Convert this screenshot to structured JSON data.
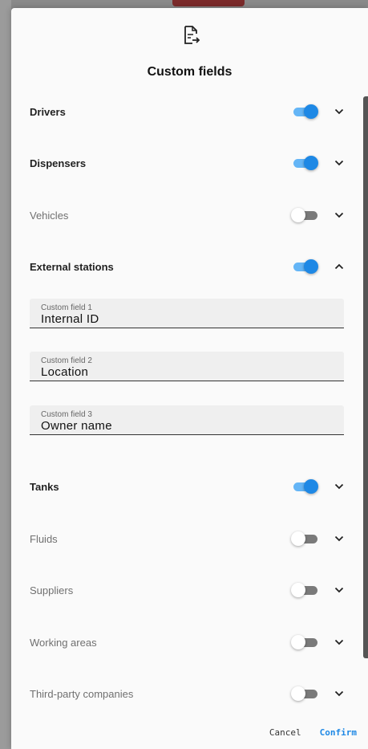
{
  "dialog": {
    "icon": "document-export-icon",
    "title": "Custom fields"
  },
  "sections": [
    {
      "id": "drivers",
      "label": "Drivers",
      "enabled": true,
      "expanded": false
    },
    {
      "id": "dispensers",
      "label": "Dispensers",
      "enabled": true,
      "expanded": false
    },
    {
      "id": "vehicles",
      "label": "Vehicles",
      "enabled": false,
      "expanded": false
    },
    {
      "id": "external-stations",
      "label": "External stations",
      "enabled": true,
      "expanded": true,
      "fields": [
        {
          "label": "Custom field 1",
          "value": "Internal ID"
        },
        {
          "label": "Custom field 2",
          "value": "Location"
        },
        {
          "label": "Custom field 3",
          "value": "Owner name"
        }
      ]
    },
    {
      "id": "tanks",
      "label": "Tanks",
      "enabled": true,
      "expanded": false
    },
    {
      "id": "fluids",
      "label": "Fluids",
      "enabled": false,
      "expanded": false
    },
    {
      "id": "suppliers",
      "label": "Suppliers",
      "enabled": false,
      "expanded": false
    },
    {
      "id": "working-areas",
      "label": "Working areas",
      "enabled": false,
      "expanded": false
    },
    {
      "id": "third-party-companies",
      "label": "Third-party companies",
      "enabled": false,
      "expanded": false
    }
  ],
  "actions": {
    "cancel_label": "Cancel",
    "confirm_label": "Confirm"
  },
  "colors": {
    "accent": "#1e88e5",
    "accent_track": "#64b5f6"
  }
}
